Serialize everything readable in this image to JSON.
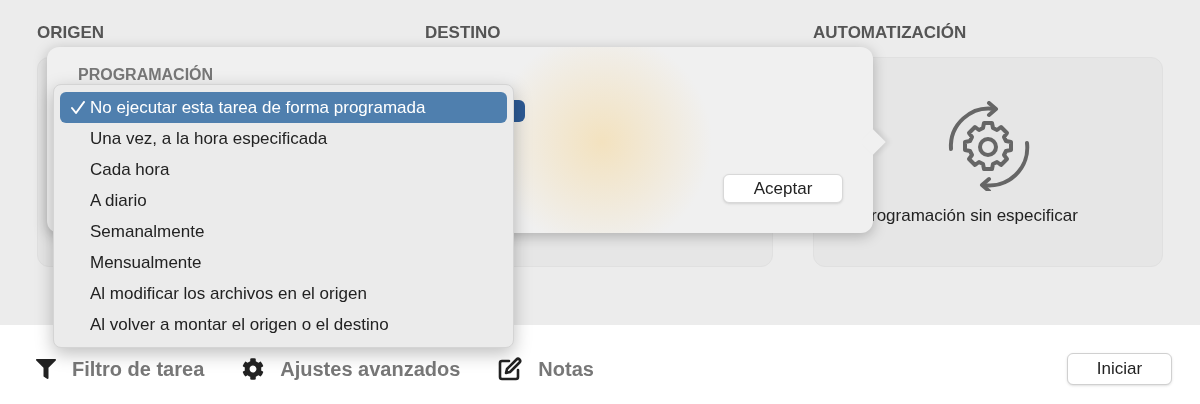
{
  "columns": [
    {
      "heading": "ORIGEN"
    },
    {
      "heading": "DESTINO"
    },
    {
      "heading": "AUTOMATIZACIÓN",
      "status": "rogramación sin especificar"
    }
  ],
  "popover": {
    "title": "PROGRAMACIÓN",
    "button": "Aceptar"
  },
  "schedule_menu": [
    {
      "label": "No ejecutar esta tarea de forma programada",
      "selected": true
    },
    {
      "label": "Una vez, a la hora especificada",
      "selected": false
    },
    {
      "label": "Cada hora",
      "selected": false
    },
    {
      "label": "A diario",
      "selected": false
    },
    {
      "label": "Semanalmente",
      "selected": false
    },
    {
      "label": "Mensualmente",
      "selected": false
    },
    {
      "label": "Al modificar los archivos en el origen",
      "selected": false
    },
    {
      "label": "Al volver a montar el origen o el destino",
      "selected": false
    }
  ],
  "toolbar": [
    {
      "kind": "filter",
      "label": "Filtro de tarea"
    },
    {
      "kind": "settings",
      "label": "Ajustes avanzados"
    },
    {
      "kind": "notes",
      "label": "Notas"
    }
  ],
  "start_button": "Iniciar"
}
